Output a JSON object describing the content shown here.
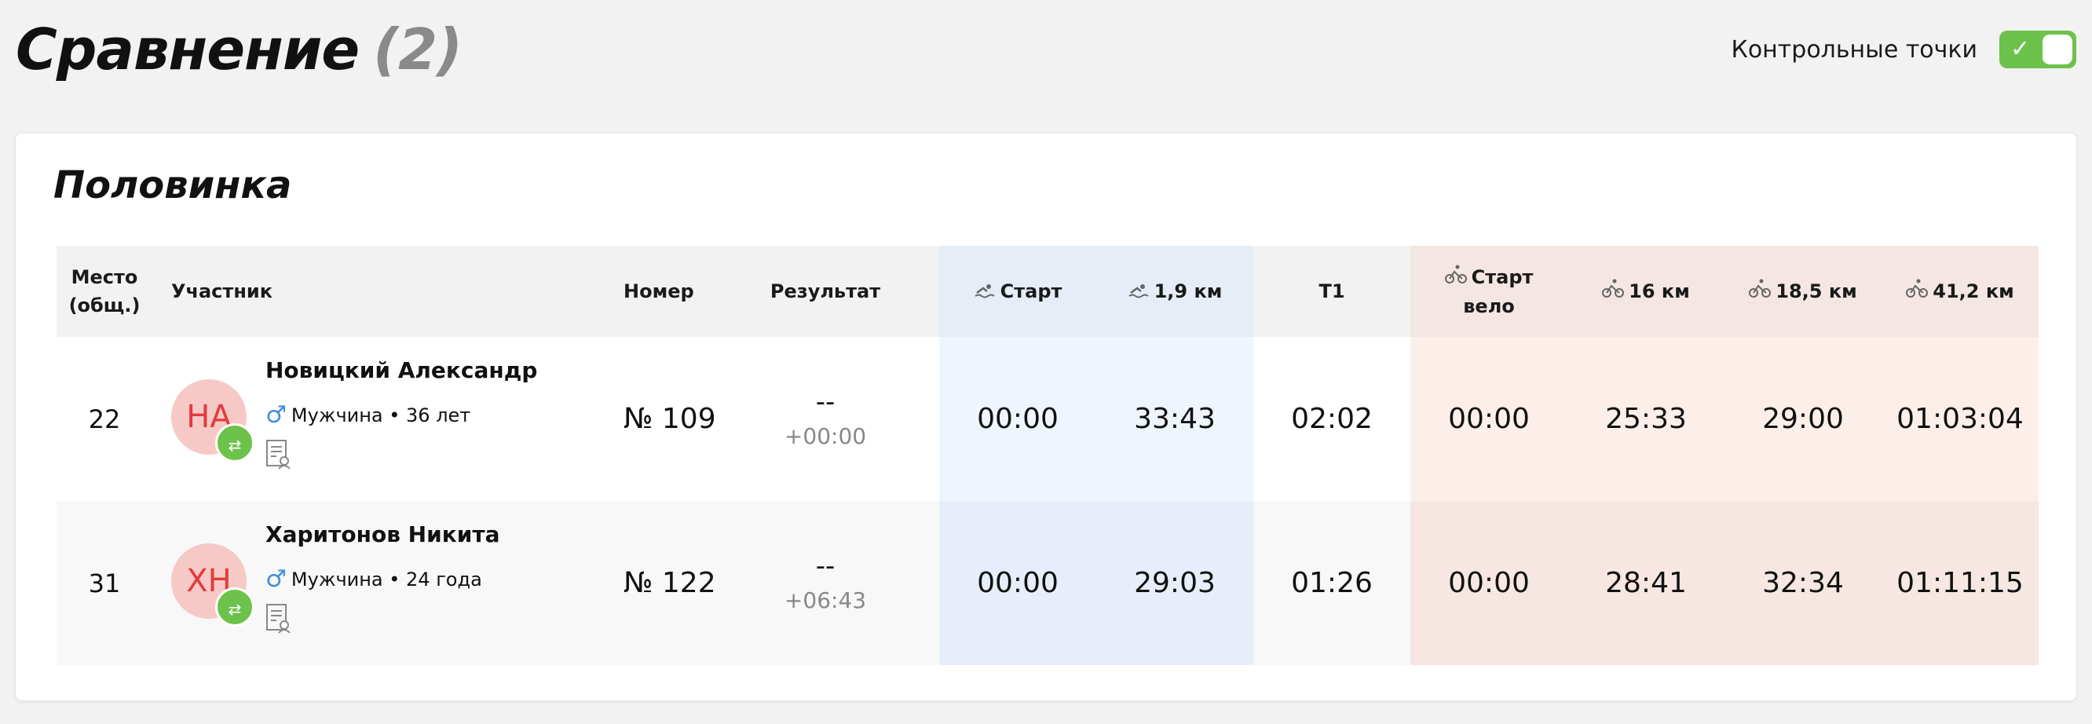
{
  "header": {
    "title": "Сравнение",
    "count": "(2)",
    "toggle_label": "Контрольные точки",
    "toggle_check": "✓"
  },
  "card": {
    "title": "Половинка"
  },
  "table": {
    "headers": {
      "place": "Место (общ.)",
      "participant": "Участник",
      "number": "Номер",
      "result": "Результат",
      "swim_start": "Старт",
      "swim_1_9": "1,9 км",
      "t1": "T1",
      "bike_start": "Старт вело",
      "bike_16": "16 км",
      "bike_18_5": "18,5 км",
      "bike_41_2": "41,2 км"
    },
    "rows": [
      {
        "place": "22",
        "initials": "НА",
        "name": "Новицкий Александр",
        "gender_icon": "♂",
        "info": "Мужчина • 36 лет",
        "number": "№ 109",
        "result": "--",
        "gap": "+00:00",
        "swim_start": "00:00",
        "swim_1_9": "33:43",
        "t1": "02:02",
        "bike_start": "00:00",
        "bike_16": "25:33",
        "bike_18_5": "29:00",
        "bike_41_2": "01:03:04"
      },
      {
        "place": "31",
        "initials": "ХН",
        "name": "Харитонов Никита",
        "gender_icon": "♂",
        "info": "Мужчина • 24 года",
        "number": "№ 122",
        "result": "--",
        "gap": "+06:43",
        "swim_start": "00:00",
        "swim_1_9": "29:03",
        "t1": "01:26",
        "bike_start": "00:00",
        "bike_16": "28:41",
        "bike_18_5": "32:34",
        "bike_41_2": "01:11:15"
      }
    ]
  },
  "icons": {
    "swim": "swim-icon",
    "bike": "bike-icon",
    "compare": "compare-icon",
    "certificate": "certificate-icon"
  },
  "colors": {
    "accent_green": "#6cc24a",
    "avatar_bg": "#f6c9c7",
    "avatar_text": "#e23b3b",
    "swim_band": "#e6edf7",
    "bike_band": "#f4e6e2",
    "male_icon": "#3f8ddb"
  }
}
